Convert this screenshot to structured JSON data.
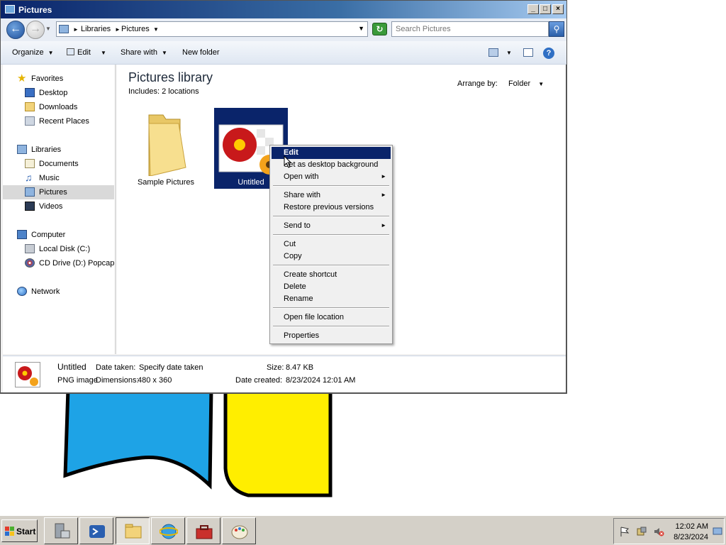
{
  "window": {
    "title": "Pictures",
    "controls": {
      "minimize": "_",
      "maximize": "□",
      "close": "×"
    }
  },
  "address": {
    "crumbs": [
      "Libraries",
      "Pictures"
    ],
    "search_placeholder": "Search Pictures"
  },
  "toolbar": {
    "organize": "Organize",
    "edit": "Edit",
    "share_with": "Share with",
    "new_folder": "New folder"
  },
  "nav": {
    "favorites": "Favorites",
    "desktop": "Desktop",
    "downloads": "Downloads",
    "recent_places": "Recent Places",
    "libraries": "Libraries",
    "documents": "Documents",
    "music": "Music",
    "pictures": "Pictures",
    "videos": "Videos",
    "computer": "Computer",
    "local_disk": "Local Disk (C:)",
    "cd_drive": "CD Drive (D:) Popcap (",
    "network": "Network"
  },
  "content": {
    "title": "Pictures library",
    "includes": "Includes:  2 locations",
    "arrange_label": "Arrange by:",
    "arrange_value": "Folder",
    "items": [
      {
        "name": "Sample Pictures",
        "type": "folder"
      },
      {
        "name": "Untitled",
        "type": "image",
        "selected": true
      }
    ]
  },
  "context_menu": {
    "items": [
      {
        "label": "Edit",
        "highlighted": true
      },
      {
        "label": "Set as desktop background"
      },
      {
        "label": "Open with",
        "submenu": true
      },
      {
        "label": "Share with",
        "submenu": true
      },
      {
        "label": "Restore previous versions"
      },
      {
        "label": "Send to",
        "submenu": true
      },
      {
        "label": "Cut"
      },
      {
        "label": "Copy"
      },
      {
        "label": "Create shortcut"
      },
      {
        "label": "Delete"
      },
      {
        "label": "Rename"
      },
      {
        "label": "Open file location"
      },
      {
        "label": "Properties"
      }
    ]
  },
  "status": {
    "name": "Untitled",
    "type": "PNG image",
    "date_taken_label": "Date taken:",
    "date_taken_value": "Specify date taken",
    "dimensions_label": "Dimensions:",
    "dimensions_value": "480 x 360",
    "size_label": "Size:",
    "size_value": "8.47 KB",
    "date_created_label": "Date created:",
    "date_created_value": "8/23/2024 12:01 AM"
  },
  "taskbar": {
    "start": "Start",
    "buttons": [
      "server-manager-icon",
      "powershell-icon",
      "explorer-icon",
      "ie-icon",
      "toolbox-icon",
      "paint-icon"
    ],
    "time": "12:02 AM",
    "date": "8/23/2024"
  },
  "colors": {
    "title_bar": "#0a246a",
    "selection": "#0a246a",
    "paint_blue": "#1ea3e6",
    "paint_yellow": "#ffee00"
  }
}
